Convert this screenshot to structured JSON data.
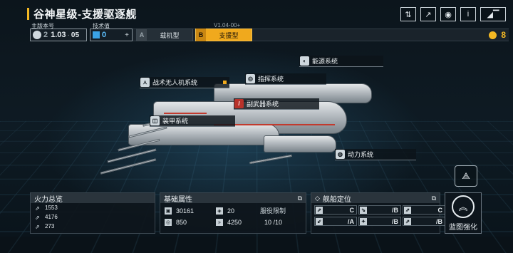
{
  "header": {
    "title": "谷神星级-支援驱逐舰",
    "icons": [
      "ship-swap-icon",
      "share-icon",
      "view-icon",
      "info-icon",
      "return-icon"
    ]
  },
  "version": {
    "main_label": "主版本号",
    "main_prefix": "2",
    "main_value": "1.03",
    "main_suffix": "05",
    "tech_label": "技术值",
    "tech_value": "0",
    "subversion": "V1.04-00+"
  },
  "modes": [
    {
      "letter": "A",
      "label": "载机型",
      "selected": false
    },
    {
      "letter": "B",
      "label": "支援型",
      "selected": true
    }
  ],
  "points": {
    "value": "8"
  },
  "systems": {
    "energy": "能源系统",
    "command": "指挥系统",
    "drone": "战术无人机系统",
    "secondary": "副武器系统",
    "armor": "装甲系统",
    "power": "动力系统"
  },
  "firepower": {
    "title": "火力总览",
    "rows": [
      "1553",
      "4176",
      "273"
    ]
  },
  "attributes": {
    "title": "基础属性",
    "hp": "30161",
    "armor": "20",
    "shield": "850",
    "speed": "4250",
    "limit_label": "服役限制",
    "limit_value": "10 /10"
  },
  "positioning": {
    "title": "舰船定位",
    "grades": [
      "C",
      "/B",
      "C",
      "/A",
      "/B",
      "/B"
    ]
  },
  "enhance": {
    "label": "蓝图强化"
  },
  "colors": {
    "accent": "#f4b823",
    "selected": "#f0a91d",
    "warning": "#c23a2e"
  }
}
